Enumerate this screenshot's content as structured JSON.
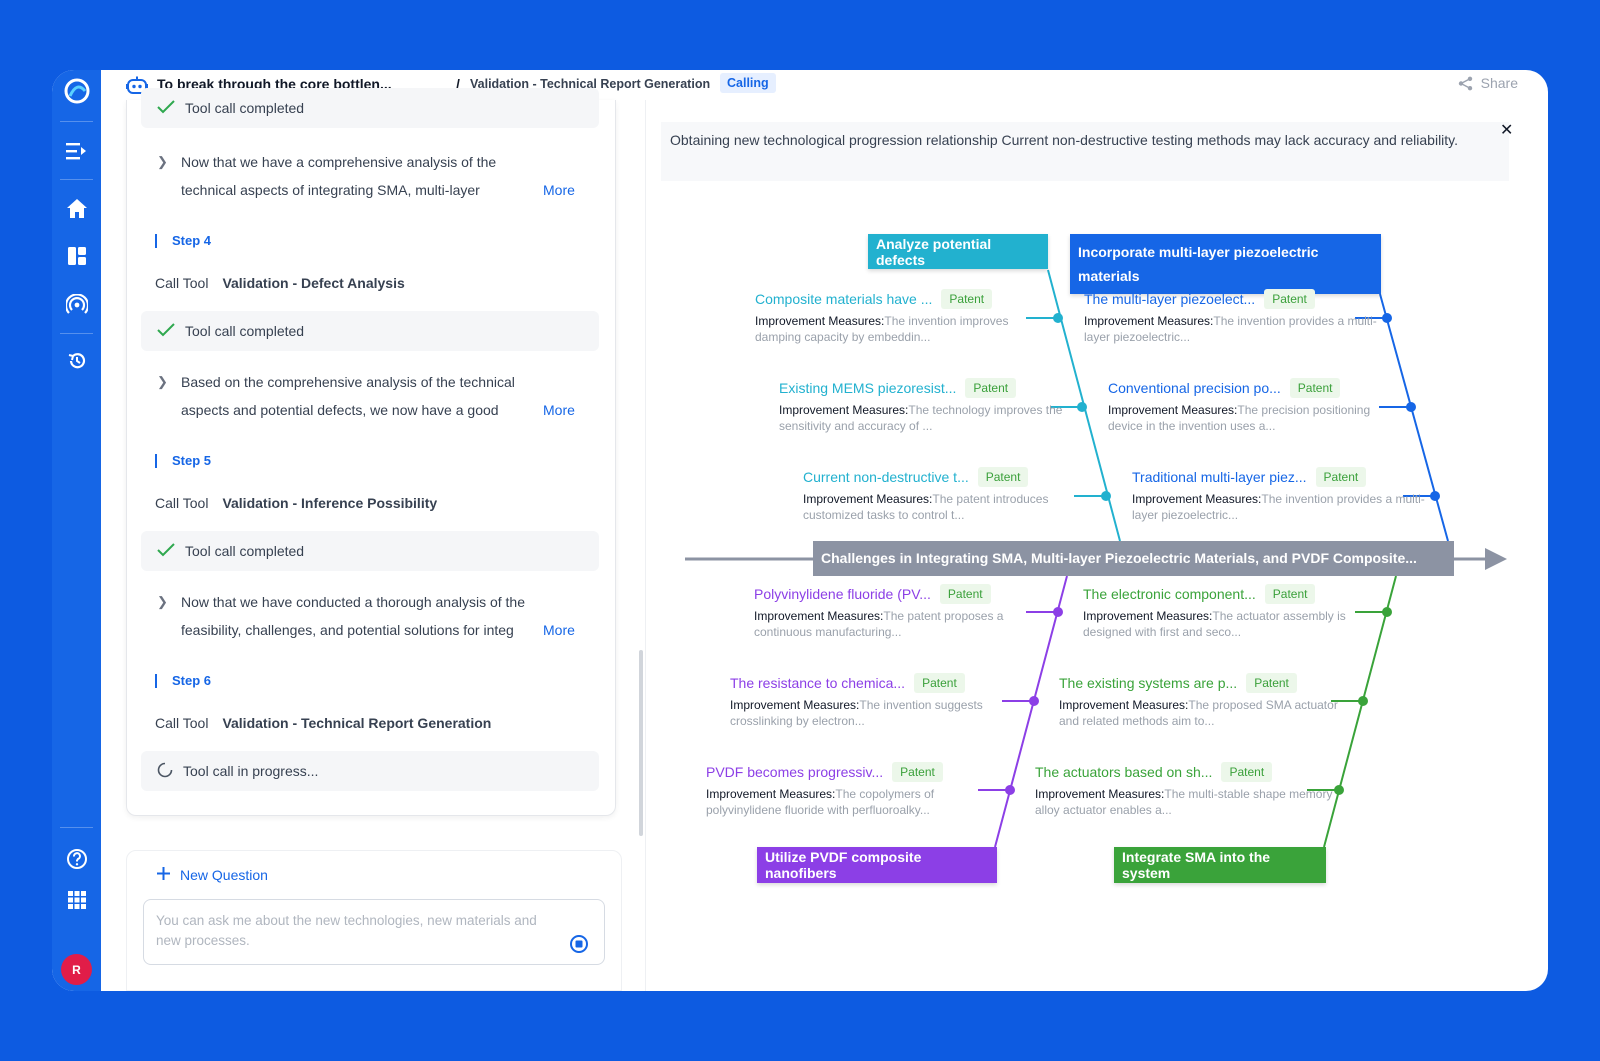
{
  "sidebar": {
    "icons": [
      "logo-icon",
      "menu-toggle-icon",
      "home-icon",
      "dashboard-icon",
      "broadcast-icon",
      "history-icon",
      "help-icon",
      "apps-grid-icon"
    ],
    "avatar_initial": "R"
  },
  "header": {
    "title": "To break through the core bottlen...",
    "separator": "/",
    "breadcrumb": "Validation - Technical Report Generation",
    "status_badge": "Calling",
    "share_label": "Share"
  },
  "chat": {
    "top_completed": "Tool call completed",
    "msg1": "Now that we have a comprehensive analysis of the technical aspects of integrating SMA, multi-layer piezoelectric",
    "more": "More",
    "step4": "Step 4",
    "call_tool": "Call Tool",
    "tool4": "Validation - Defect Analysis",
    "completed4": "Tool call completed",
    "msg2": "Based on the comprehensive analysis of the technical aspects and potential defects, we now have a good",
    "step5": "Step 5",
    "tool5": "Validation - Inference Possibility",
    "completed5": "Tool call completed",
    "msg3": "Now that we have conducted a thorough analysis of the feasibility, challenges, and potential solutions for integ",
    "step6": "Step 6",
    "tool6": "Validation - Technical Report Generation",
    "progress6": "Tool call in progress...",
    "new_question": "New Question",
    "input_placeholder": "You can ask me about the new technologies, new materials and new processes."
  },
  "diagram": {
    "banner": "Obtaining new technological progression relationship Current non-destructive testing methods may lack accuracy and reliability.",
    "spine": "Challenges in Integrating SMA, Multi-layer Piezoelectric Materials, and PVDF Composite...",
    "measures_label": "Improvement Measures:",
    "patent_tag": "Patent",
    "categories": {
      "c1": {
        "label": "Analyze potential defects",
        "color": "#22b1cf"
      },
      "c2": {
        "label": "Incorporate multi-layer piezoelectric materials",
        "color": "#1666e6"
      },
      "c3": {
        "label": "Utilize PVDF composite nanofibers",
        "color": "#8c3fe6"
      },
      "c4": {
        "label": "Integrate SMA into the system",
        "color": "#3aa33a"
      }
    },
    "nodes": [
      {
        "title": "Composite materials have ...",
        "desc": "The invention improves damping capacity by embeddin..."
      },
      {
        "title": "Existing MEMS piezoresist...",
        "desc": "The technology improves the sensitivity and accuracy of ..."
      },
      {
        "title": "Current non-destructive t...",
        "desc": "The patent introduces customized tasks to control t..."
      },
      {
        "title": "The multi-layer piezoelect...",
        "desc": "The invention provides a multi-layer piezoelectric..."
      },
      {
        "title": "Conventional precision po...",
        "desc": "The precision positioning device in the invention uses a..."
      },
      {
        "title": "Traditional multi-layer piez...",
        "desc": "The invention provides a multi-layer piezoelectric..."
      },
      {
        "title": "Polyvinylidene fluoride (PV...",
        "desc": "The patent proposes a continuous manufacturing..."
      },
      {
        "title": "The resistance to chemica...",
        "desc": "The invention suggests crosslinking by electron..."
      },
      {
        "title": "PVDF becomes progressiv...",
        "desc": "The copolymers of polyvinylidene fluoride with perfluoroalky..."
      },
      {
        "title": "The electronic component...",
        "desc": "The actuator assembly is designed with first and seco..."
      },
      {
        "title": "The existing systems are p...",
        "desc": "The proposed SMA actuator and related methods aim to..."
      },
      {
        "title": "The actuators based on sh...",
        "desc": "The multi-stable shape memory alloy actuator enables a..."
      }
    ]
  }
}
